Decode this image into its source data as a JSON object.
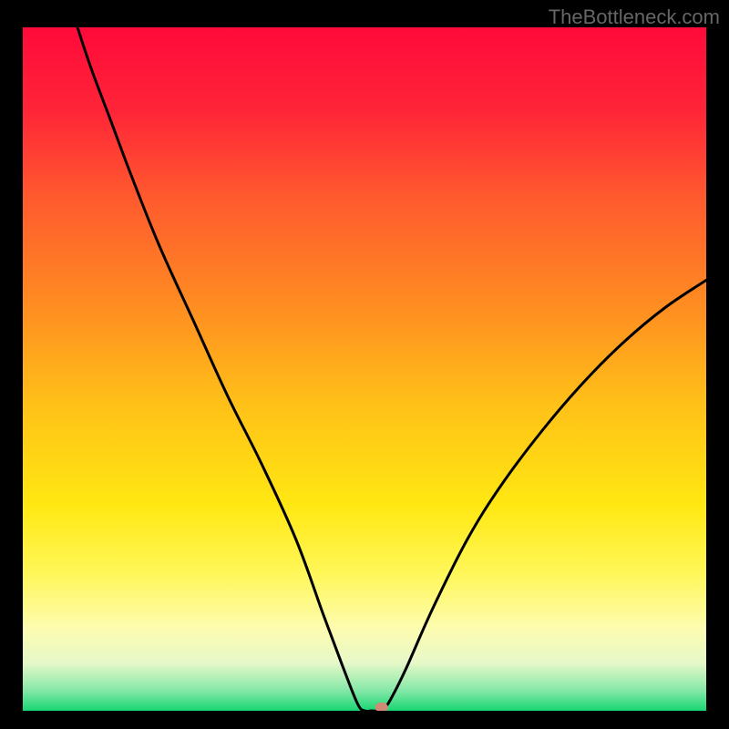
{
  "watermark": "TheBottleneck.com",
  "chart_data": {
    "type": "line",
    "title": "",
    "xlabel": "",
    "ylabel": "",
    "xlim": [
      0,
      100
    ],
    "ylim": [
      0,
      100
    ],
    "gradient_stops": [
      {
        "offset": 0.0,
        "color": "#ff0a3a"
      },
      {
        "offset": 0.12,
        "color": "#ff2438"
      },
      {
        "offset": 0.25,
        "color": "#ff5a2e"
      },
      {
        "offset": 0.4,
        "color": "#ff8a22"
      },
      {
        "offset": 0.55,
        "color": "#ffc018"
      },
      {
        "offset": 0.7,
        "color": "#ffe812"
      },
      {
        "offset": 0.8,
        "color": "#fff75a"
      },
      {
        "offset": 0.88,
        "color": "#fdfcb0"
      },
      {
        "offset": 0.93,
        "color": "#e6f8c8"
      },
      {
        "offset": 0.97,
        "color": "#86e8a8"
      },
      {
        "offset": 1.0,
        "color": "#18d672"
      }
    ],
    "series": [
      {
        "name": "bottleneck-curve",
        "x": [
          8,
          10,
          13,
          16,
          20,
          25,
          30,
          35,
          40,
          44,
          47,
          49,
          50,
          51,
          52,
          53,
          54,
          56,
          60,
          65,
          70,
          76,
          82,
          88,
          94,
          100
        ],
        "y": [
          100,
          94,
          86,
          78,
          68,
          57,
          46,
          36,
          25,
          14,
          6,
          1,
          0,
          0,
          0,
          0.5,
          2,
          6,
          15,
          25,
          33,
          41,
          48,
          54,
          59,
          63
        ]
      }
    ],
    "marker": {
      "x": 52.5,
      "y": 0.5,
      "color": "#d28a78"
    }
  }
}
